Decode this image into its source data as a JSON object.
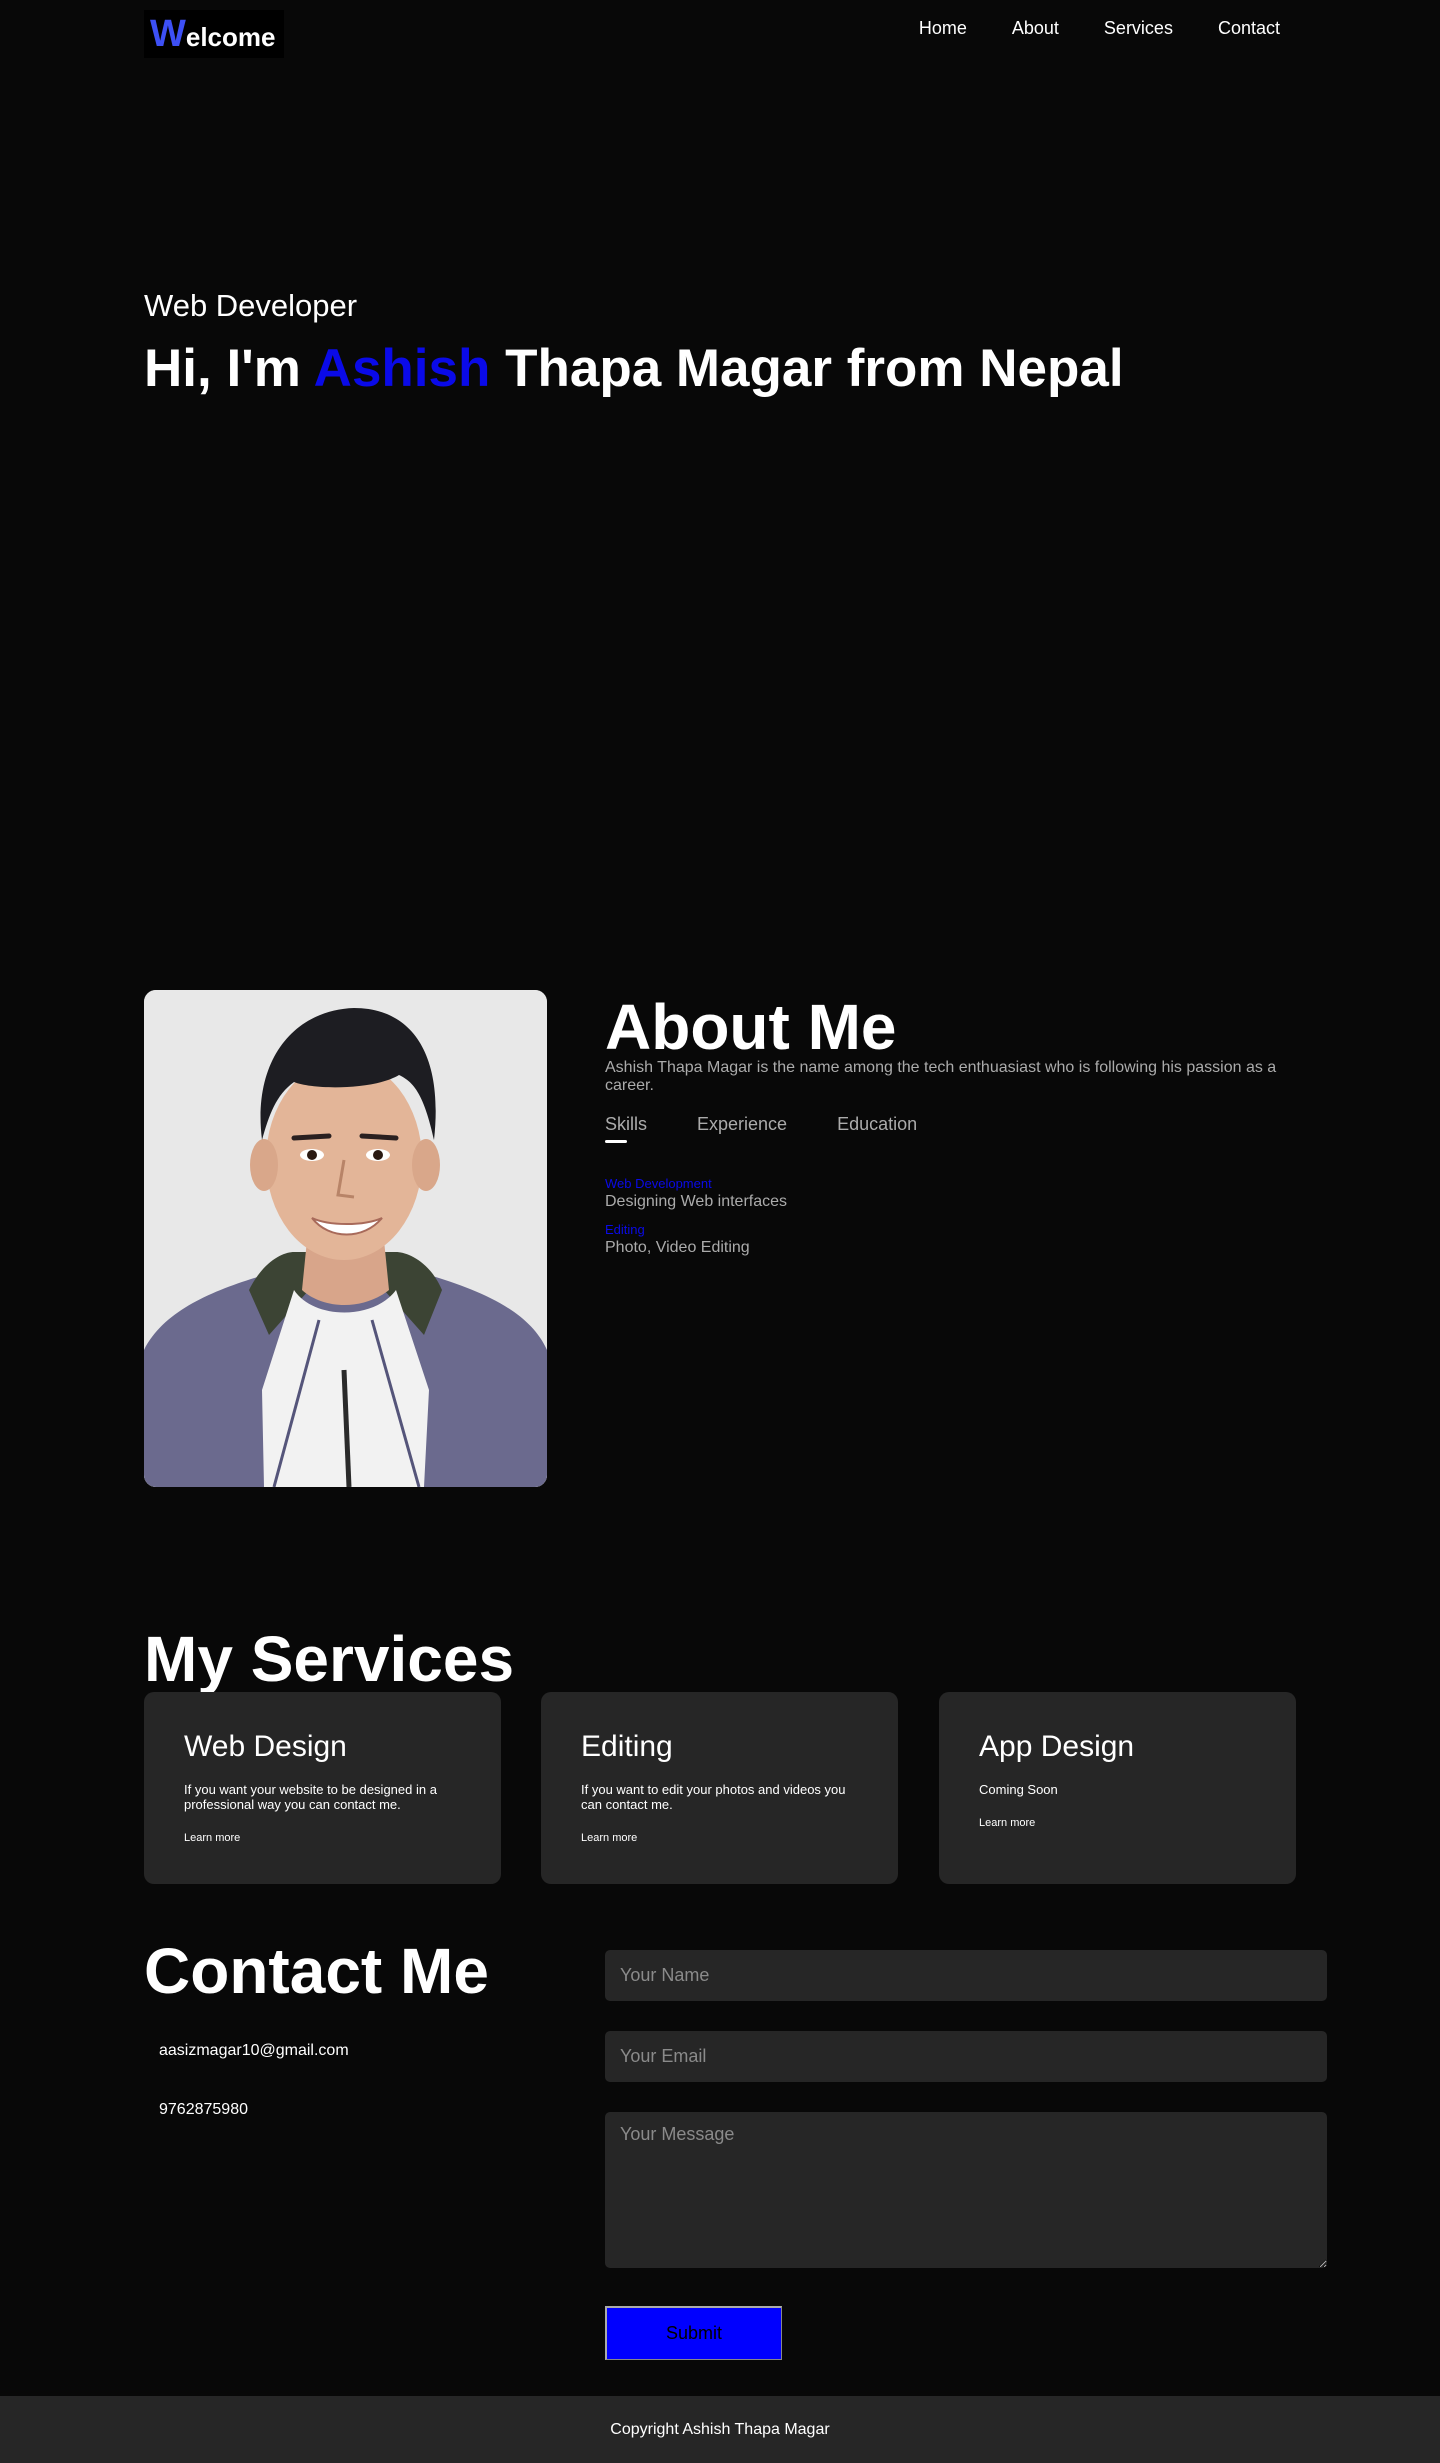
{
  "header": {
    "logo_first_letter": "W",
    "logo_rest": "elcome",
    "nav": [
      {
        "label": "Home"
      },
      {
        "label": "About"
      },
      {
        "label": "Services"
      },
      {
        "label": "Contact"
      }
    ]
  },
  "hero": {
    "subtitle": "Web Developer",
    "title_prefix": "Hi, I'm ",
    "title_accent": "Ashish",
    "title_suffix": " Thapa Magar from Nepal",
    "accent_color": "#0a0ae8"
  },
  "about": {
    "title": "About Me",
    "description": "Ashish Thapa Magar is the name among the tech enthuasiast who is following his passion as a career.",
    "tabs": [
      {
        "label": "Skills",
        "active": true
      },
      {
        "label": "Experience",
        "active": false
      },
      {
        "label": "Education",
        "active": false
      }
    ],
    "skills": [
      {
        "name": "Web Development",
        "desc": "Designing Web interfaces"
      },
      {
        "name": "Editing",
        "desc": "Photo, Video Editing"
      }
    ]
  },
  "services": {
    "title": "My Services",
    "cards": [
      {
        "title": "Web Design",
        "text": "If you want your website to be designed in a professional way you can contact me.",
        "link": "Learn more"
      },
      {
        "title": "Editing",
        "text": "If you want to edit your photos and videos you can contact me.",
        "link": "Learn more"
      },
      {
        "title": "App Design",
        "text": "Coming Soon",
        "link": "Learn more"
      }
    ]
  },
  "contact": {
    "title": "Contact Me",
    "email": "aasizmagar10@gmail.com",
    "phone": "9762875980",
    "name_placeholder": "Your Name",
    "email_placeholder": "Your Email",
    "message_placeholder": "Your Message",
    "submit_label": "Submit"
  },
  "footer": {
    "copyright": "Copyright Ashish Thapa Magar"
  }
}
